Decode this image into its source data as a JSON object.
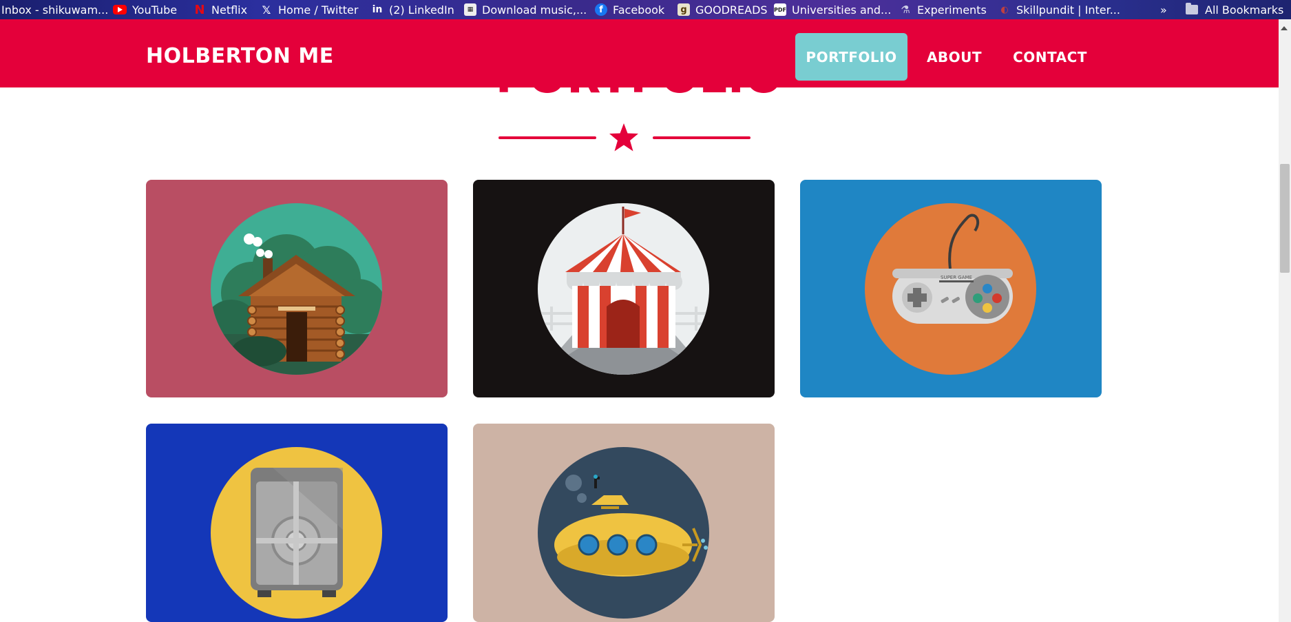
{
  "bookmarks": {
    "items": [
      {
        "label": "Inbox - shikuwam...",
        "icon": "gmail-icon"
      },
      {
        "label": "YouTube",
        "icon": "youtube-icon"
      },
      {
        "label": "Netflix",
        "icon": "netflix-icon"
      },
      {
        "label": "Home / Twitter",
        "icon": "x-twitter-icon"
      },
      {
        "label": "(2) LinkedIn",
        "icon": "linkedin-icon"
      },
      {
        "label": "Download music,...",
        "icon": "download-music-icon"
      },
      {
        "label": "Facebook",
        "icon": "facebook-icon"
      },
      {
        "label": "GOODREADS",
        "icon": "goodreads-icon"
      },
      {
        "label": "Universities and...",
        "icon": "pdf-icon"
      },
      {
        "label": "Experiments",
        "icon": "flask-icon"
      },
      {
        "label": "Skillpundit | Inter...",
        "icon": "skillpundit-icon"
      }
    ],
    "overflow_label": "»",
    "all_bookmarks_label": "All Bookmarks"
  },
  "navbar": {
    "brand": "HOLBERTON ME",
    "items": [
      {
        "label": "PORTFOLIO",
        "active": true
      },
      {
        "label": "ABOUT",
        "active": false
      },
      {
        "label": "CONTACT",
        "active": false
      }
    ]
  },
  "section": {
    "heading": "PORTFOLIO"
  },
  "portfolio": {
    "items": [
      {
        "name": "cabin",
        "background": "#b94e63",
        "circle": "#3fae94"
      },
      {
        "name": "circus-tent",
        "background": "#161212",
        "circle": "#eceff0"
      },
      {
        "name": "game-controller",
        "background": "#1f86c4",
        "circle": "#e07a3a",
        "controller_text": "SUPER GAME"
      },
      {
        "name": "safe",
        "background": "#1437b8",
        "circle": "#efc341"
      },
      {
        "name": "submarine",
        "background": "#cdb3a5",
        "circle": "#33495e"
      }
    ]
  },
  "colors": {
    "primary": "#e4003a",
    "active_nav": "#79cdd1"
  }
}
